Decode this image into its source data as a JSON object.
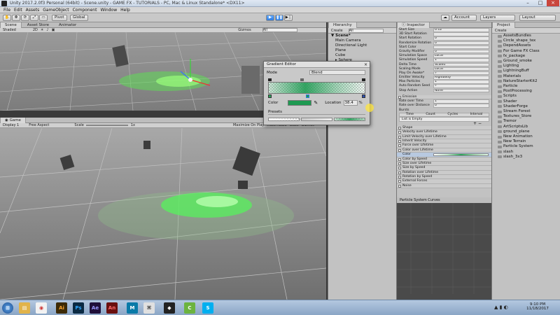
{
  "window": {
    "title": "Unity 2017.2.0f3 Personal (64bit) - Scene.unity - GAME FX - TUTORIALS - PC, Mac & Linux Standalone* <DX11>"
  },
  "menu": [
    "File",
    "Edit",
    "Assets",
    "GameObject",
    "Component",
    "Window",
    "Help"
  ],
  "toolbar": {
    "pivot": "Pivot",
    "global": "Global",
    "account": "Account",
    "layers": "Layers",
    "layout": "Layout"
  },
  "scene": {
    "tabs": [
      "Scene",
      "Asset Store",
      "Animator"
    ],
    "shaded": "Shaded",
    "mode2d": "2D",
    "gizmos": "Gizmos",
    "search": "All"
  },
  "game": {
    "tab": "Game",
    "display": "Display 1",
    "aspect": "Free Aspect",
    "scale_label": "Scale",
    "scale_value": "1x",
    "maximize": "Maximize On Play",
    "mute": "Mute Audio",
    "stats": "Stats",
    "gizmos": "Gizmos"
  },
  "hierarchy": {
    "tab": "Hierarchy",
    "create": "Create",
    "search": "All",
    "root": "Scene*",
    "items": [
      "Main Camera",
      "Directional Light",
      "Plane",
      "Cube",
      "Sphere"
    ]
  },
  "inspector": {
    "tab": "Inspector",
    "props": [
      {
        "label": "Start Size",
        "value": "0.12"
      },
      {
        "label": "3D Start Rotation",
        "value": ""
      },
      {
        "label": "Start Rotation",
        "value": "0"
      },
      {
        "label": "Randomize Rotation",
        "value": "0"
      },
      {
        "label": "Start Color",
        "value": ""
      },
      {
        "label": "Gravity Modifier",
        "value": "0"
      },
      {
        "label": "Simulation Space",
        "value": "Local"
      },
      {
        "label": "Simulation Speed",
        "value": "1"
      },
      {
        "label": "Delta Time",
        "value": "Scaled"
      },
      {
        "label": "Scaling Mode",
        "value": "Local"
      },
      {
        "label": "Play On Awake*",
        "value": "✓"
      },
      {
        "label": "Emitter Velocity",
        "value": "Rigidbody"
      },
      {
        "label": "Max Particles",
        "value": "1"
      },
      {
        "label": "Auto Random Seed",
        "value": "✓"
      },
      {
        "label": "Stop Action",
        "value": "None"
      }
    ],
    "emission": {
      "header": "Emission",
      "rate_time_label": "Rate over Time",
      "rate_time_value": "1",
      "rate_distance_label": "Rate over Distance",
      "rate_distance_value": "0",
      "bursts": "Bursts",
      "burst_cols": [
        "Time",
        "Count",
        "Cycles",
        "Interval"
      ],
      "list_empty": "List is Empty"
    },
    "modules": [
      "Shape",
      "Velocity over Lifetime",
      "Limit Velocity over Lifetime",
      "Inherit Velocity",
      "Force over Lifetime",
      "Color over Lifetime"
    ],
    "color_label": "Color",
    "modules2": [
      "Color by Speed",
      "Size over Lifetime",
      "Size by Speed",
      "Rotation over Lifetime",
      "Rotation by Speed",
      "External Forces",
      "Noise"
    ],
    "curves": "Particle System Curves"
  },
  "project": {
    "tab": "Project",
    "create": "Create",
    "items": [
      "AssetsBundles",
      "Circle_shape_tex",
      "DependAssets",
      "For Game FX Class",
      "fx_package",
      "Ground_smoke",
      "Lighting",
      "LightningBuff",
      "Materials",
      "NatureStarterKit2",
      "Particle",
      "PostProcessing",
      "Scripts",
      "Shader",
      "ShaderForge",
      "Stream Forest",
      "Textures_Store",
      "Tremor",
      "ArtScriptsLib",
      "ground_plane",
      "New Animation",
      "New Terrain",
      "Particle System",
      "slash",
      "slash_3x3"
    ]
  },
  "gradient_editor": {
    "title": "Gradient Editor",
    "mode_label": "Mode",
    "mode_value": "Blend",
    "color_label": "Color",
    "location_label": "Location",
    "location_value": "38.4",
    "percent": "%",
    "presets_label": "Presets",
    "swatch_color": "#1f9a52"
  },
  "taskbar": {
    "time": "9:10 PM",
    "date": "11/18/2017"
  },
  "colors": {
    "unity_blue": "#2f7de0",
    "particle_green": "#4dff5a"
  }
}
